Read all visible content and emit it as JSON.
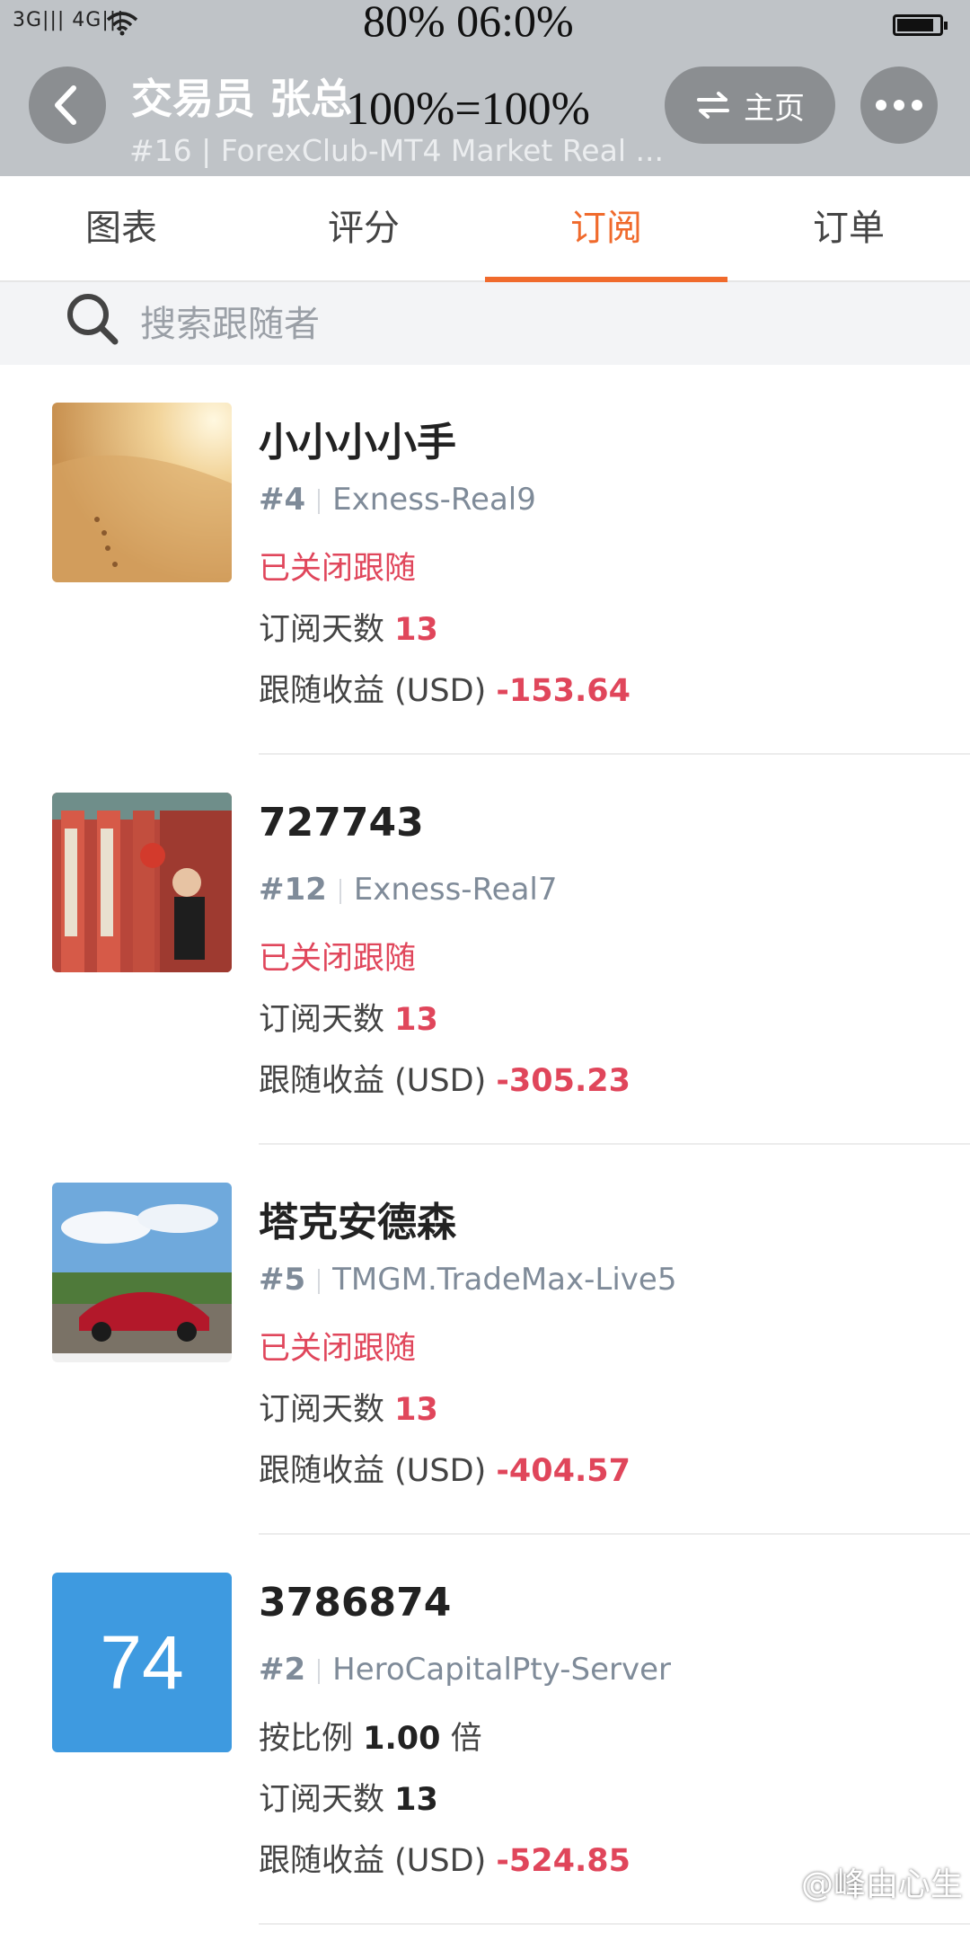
{
  "status_bar": {
    "signal": "3G||| 4G|||",
    "battery_pct": "80% 06:0%",
    "overlay": "100%=100%"
  },
  "header": {
    "title": "交易员  张总",
    "subtitle": "#16 | ForexClub-MT4 Market Real ...",
    "home_label": "主页"
  },
  "tabs": [
    {
      "label": "图表"
    },
    {
      "label": "评分"
    },
    {
      "label": "订阅"
    },
    {
      "label": "订单"
    }
  ],
  "search": {
    "placeholder": "搜索跟随者"
  },
  "followers": [
    {
      "name": "小小小小手",
      "rank": "#4",
      "server": "Exness-Real9",
      "status": "已关闭跟随",
      "days_label": "订阅天数",
      "days": "13",
      "profit_label": "跟随收益 (USD)",
      "profit": "-153.64"
    },
    {
      "name": "727743",
      "rank": "#12",
      "server": "Exness-Real7",
      "status": "已关闭跟随",
      "days_label": "订阅天数",
      "days": "13",
      "profit_label": "跟随收益 (USD)",
      "profit": "-305.23"
    },
    {
      "name": "塔克安德森",
      "rank": "#5",
      "server": "TMGM.TradeMax-Live5",
      "status": "已关闭跟随",
      "days_label": "订阅天数",
      "days": "13",
      "profit_label": "跟随收益 (USD)",
      "profit": "-404.57"
    },
    {
      "name": "3786874",
      "avatar_text": "74",
      "rank": "#2",
      "server": "HeroCapitalPty-Server",
      "ratio_prefix": "按比例",
      "ratio": "1.00",
      "ratio_suffix": "倍",
      "days_label": "订阅天数",
      "days": "13",
      "profit_label": "跟随收益 (USD)",
      "profit": "-524.85"
    }
  ],
  "watermark": "@峰由心生",
  "colors": {
    "accent": "#f06a2c",
    "negative": "#e0465b",
    "header_bg": "#bfc3c7",
    "avatar_blue": "#3e9ae0"
  }
}
